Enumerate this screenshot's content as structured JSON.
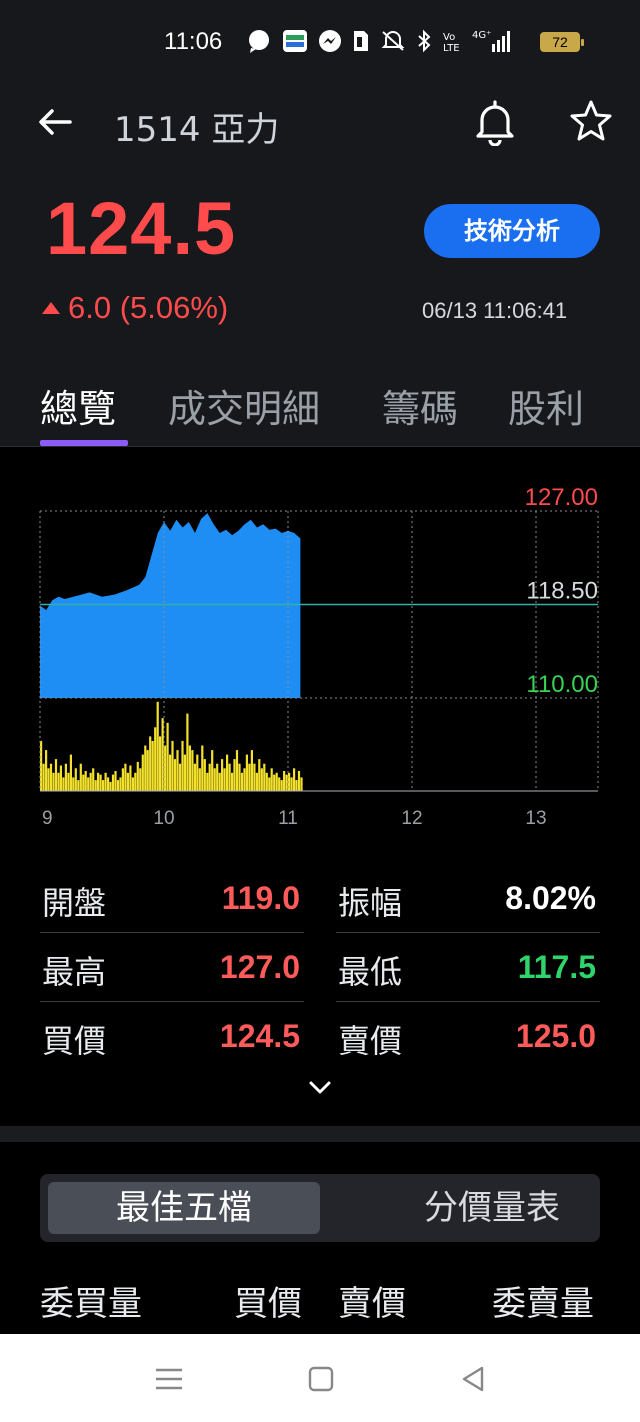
{
  "status_bar": {
    "time": "11:06",
    "battery": "72",
    "icons": [
      "chat-icon",
      "app-icon",
      "messenger-icon",
      "sim-icon",
      "mute-icon",
      "bluetooth-icon",
      "volte-icon",
      "signal-4g-icon"
    ]
  },
  "header": {
    "stock_title": "1514 亞力",
    "price": "124.5",
    "change": "6.0 (5.06%)",
    "datetime": "06/13 11:06:41",
    "tech_button": "技術分析"
  },
  "tabs": [
    {
      "label": "總覽",
      "active": true
    },
    {
      "label": "成交明細",
      "active": false
    },
    {
      "label": "籌碼",
      "active": false
    },
    {
      "label": "股利",
      "active": false
    }
  ],
  "chart_data": {
    "type": "area",
    "y_labels": [
      {
        "value": "127.00",
        "color": "#ff4b4b"
      },
      {
        "value": "118.50",
        "color": "#d6d9de"
      },
      {
        "value": "110.00",
        "color": "#39d353"
      }
    ],
    "ylim": [
      110.0,
      127.0
    ],
    "reference": 118.5,
    "x_ticks": [
      "9",
      "10",
      "11",
      "12",
      "13"
    ],
    "price_series": [
      [
        9.0,
        118.4
      ],
      [
        9.05,
        118.0
      ],
      [
        9.1,
        118.9
      ],
      [
        9.15,
        119.2
      ],
      [
        9.2,
        119.0
      ],
      [
        9.3,
        119.3
      ],
      [
        9.4,
        119.6
      ],
      [
        9.5,
        119.2
      ],
      [
        9.6,
        119.4
      ],
      [
        9.7,
        119.8
      ],
      [
        9.8,
        120.3
      ],
      [
        9.85,
        121.0
      ],
      [
        9.9,
        123.0
      ],
      [
        9.95,
        125.0
      ],
      [
        10.0,
        126.0
      ],
      [
        10.05,
        125.2
      ],
      [
        10.1,
        126.2
      ],
      [
        10.15,
        125.5
      ],
      [
        10.2,
        126.0
      ],
      [
        10.25,
        125.0
      ],
      [
        10.3,
        126.3
      ],
      [
        10.35,
        126.8
      ],
      [
        10.4,
        125.8
      ],
      [
        10.45,
        125.0
      ],
      [
        10.5,
        125.3
      ],
      [
        10.55,
        124.8
      ],
      [
        10.6,
        125.2
      ],
      [
        10.65,
        125.8
      ],
      [
        10.7,
        126.2
      ],
      [
        10.75,
        125.5
      ],
      [
        10.8,
        125.8
      ],
      [
        10.85,
        125.3
      ],
      [
        10.9,
        125.4
      ],
      [
        10.95,
        125.0
      ],
      [
        11.0,
        125.2
      ],
      [
        11.05,
        125.0
      ],
      [
        11.1,
        124.5
      ]
    ],
    "volume_series": [
      [
        9.0,
        0.55
      ],
      [
        9.02,
        0.3
      ],
      [
        9.04,
        0.45
      ],
      [
        9.06,
        0.25
      ],
      [
        9.08,
        0.3
      ],
      [
        9.1,
        0.2
      ],
      [
        9.12,
        0.35
      ],
      [
        9.14,
        0.2
      ],
      [
        9.16,
        0.28
      ],
      [
        9.18,
        0.15
      ],
      [
        9.2,
        0.3
      ],
      [
        9.22,
        0.2
      ],
      [
        9.24,
        0.4
      ],
      [
        9.26,
        0.15
      ],
      [
        9.28,
        0.25
      ],
      [
        9.3,
        0.12
      ],
      [
        9.32,
        0.3
      ],
      [
        9.34,
        0.18
      ],
      [
        9.36,
        0.22
      ],
      [
        9.38,
        0.15
      ],
      [
        9.4,
        0.2
      ],
      [
        9.42,
        0.25
      ],
      [
        9.44,
        0.12
      ],
      [
        9.46,
        0.2
      ],
      [
        9.48,
        0.18
      ],
      [
        9.5,
        0.12
      ],
      [
        9.52,
        0.2
      ],
      [
        9.54,
        0.15
      ],
      [
        9.56,
        0.1
      ],
      [
        9.58,
        0.18
      ],
      [
        9.6,
        0.22
      ],
      [
        9.62,
        0.12
      ],
      [
        9.64,
        0.15
      ],
      [
        9.66,
        0.25
      ],
      [
        9.68,
        0.3
      ],
      [
        9.7,
        0.2
      ],
      [
        9.72,
        0.28
      ],
      [
        9.74,
        0.15
      ],
      [
        9.76,
        0.2
      ],
      [
        9.78,
        0.32
      ],
      [
        9.8,
        0.25
      ],
      [
        9.82,
        0.4
      ],
      [
        9.84,
        0.5
      ],
      [
        9.86,
        0.45
      ],
      [
        9.88,
        0.6
      ],
      [
        9.9,
        0.55
      ],
      [
        9.92,
        0.7
      ],
      [
        9.94,
        0.98
      ],
      [
        9.96,
        0.6
      ],
      [
        9.98,
        0.8
      ],
      [
        10.0,
        0.5
      ],
      [
        10.02,
        0.75
      ],
      [
        10.04,
        0.4
      ],
      [
        10.06,
        0.55
      ],
      [
        10.08,
        0.35
      ],
      [
        10.1,
        0.45
      ],
      [
        10.12,
        0.3
      ],
      [
        10.14,
        0.55
      ],
      [
        10.16,
        0.4
      ],
      [
        10.18,
        0.85
      ],
      [
        10.2,
        0.5
      ],
      [
        10.22,
        0.45
      ],
      [
        10.24,
        0.3
      ],
      [
        10.26,
        0.4
      ],
      [
        10.28,
        0.25
      ],
      [
        10.3,
        0.5
      ],
      [
        10.32,
        0.35
      ],
      [
        10.34,
        0.2
      ],
      [
        10.36,
        0.3
      ],
      [
        10.38,
        0.45
      ],
      [
        10.4,
        0.25
      ],
      [
        10.42,
        0.3
      ],
      [
        10.44,
        0.2
      ],
      [
        10.46,
        0.35
      ],
      [
        10.48,
        0.25
      ],
      [
        10.5,
        0.4
      ],
      [
        10.52,
        0.3
      ],
      [
        10.54,
        0.2
      ],
      [
        10.56,
        0.35
      ],
      [
        10.58,
        0.45
      ],
      [
        10.6,
        0.3
      ],
      [
        10.62,
        0.2
      ],
      [
        10.64,
        0.25
      ],
      [
        10.66,
        0.4
      ],
      [
        10.68,
        0.3
      ],
      [
        10.7,
        0.45
      ],
      [
        10.72,
        0.3
      ],
      [
        10.74,
        0.2
      ],
      [
        10.76,
        0.35
      ],
      [
        10.78,
        0.25
      ],
      [
        10.8,
        0.3
      ],
      [
        10.82,
        0.2
      ],
      [
        10.84,
        0.15
      ],
      [
        10.86,
        0.25
      ],
      [
        10.88,
        0.18
      ],
      [
        10.9,
        0.2
      ],
      [
        10.92,
        0.15
      ],
      [
        10.94,
        0.12
      ],
      [
        10.96,
        0.22
      ],
      [
        10.98,
        0.18
      ],
      [
        11.0,
        0.2
      ],
      [
        11.02,
        0.15
      ],
      [
        11.04,
        0.25
      ],
      [
        11.06,
        0.12
      ],
      [
        11.08,
        0.22
      ],
      [
        11.1,
        0.15
      ]
    ],
    "grid": true,
    "colors": {
      "price_fill": "#1e8ef5",
      "volume": "#f3e12c",
      "reference_line": "#2fb1a8",
      "grid": "#8a8d93"
    }
  },
  "quotes": [
    [
      {
        "label": "開盤",
        "value": "119.0",
        "color": "#ff5b5b"
      },
      {
        "label": "振幅",
        "value": "8.02%",
        "color": "#ffffff"
      }
    ],
    [
      {
        "label": "最高",
        "value": "127.0",
        "color": "#ff5b5b"
      },
      {
        "label": "最低",
        "value": "117.5",
        "color": "#2fd56b"
      }
    ],
    [
      {
        "label": "買價",
        "value": "124.5",
        "color": "#ff5b5b"
      },
      {
        "label": "賣價",
        "value": "125.0",
        "color": "#ff5b5b"
      }
    ]
  ],
  "segment": {
    "active": "最佳五檔",
    "inactive": "分價量表"
  },
  "orderbook_headers": [
    "委買量",
    "買價",
    "賣價",
    "委賣量"
  ]
}
